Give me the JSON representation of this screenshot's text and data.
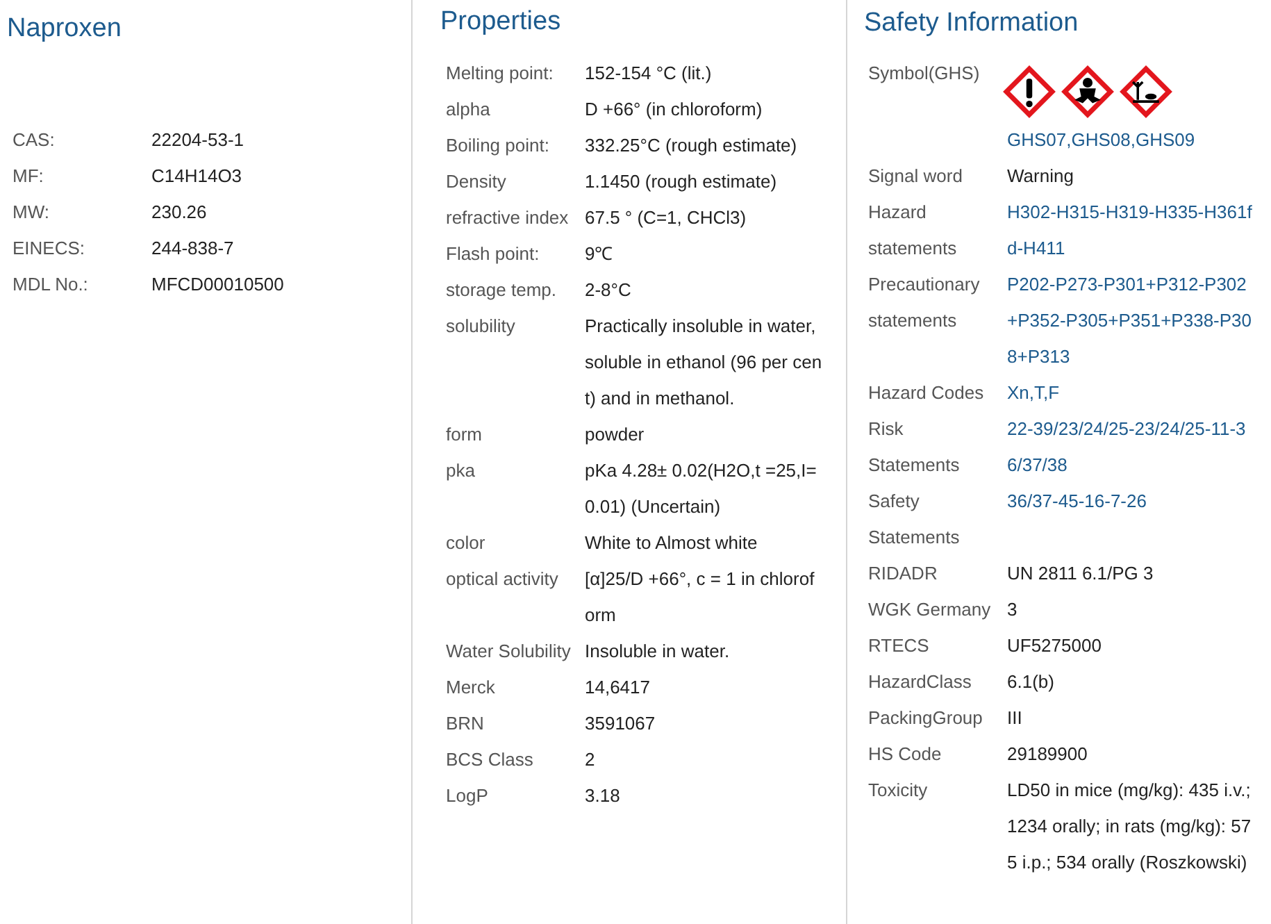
{
  "sections": [
    {
      "title": "Naproxen",
      "kind": "identity",
      "rows": [
        {
          "label": "CAS:",
          "value": "22204-53-1",
          "link": false
        },
        {
          "label": "MF:",
          "value": "C14H14O3",
          "link": false
        },
        {
          "label": "MW:",
          "value": "230.26",
          "link": false
        },
        {
          "label": "EINECS:",
          "value": "244-838-7",
          "link": false
        },
        {
          "label": "MDL No.:",
          "value": "MFCD00010500",
          "link": false
        }
      ]
    },
    {
      "title": "Properties",
      "kind": "properties",
      "rows": [
        {
          "label": "Melting point:",
          "value": "152-154 °C (lit.)",
          "link": false
        },
        {
          "label": "alpha",
          "value": "D +66° (in chloroform)",
          "link": false
        },
        {
          "label": "Boiling point:",
          "value": "332.25°C (rough estimate)",
          "link": false
        },
        {
          "label": "Density",
          "value": "1.1450 (rough estimate)",
          "link": false
        },
        {
          "label": "refractive index",
          "value": "67.5 ° (C=1, CHCl3)",
          "link": false
        },
        {
          "label": "Flash point:",
          "value": "9℃",
          "link": false
        },
        {
          "label": "storage temp.",
          "value": "2-8°C",
          "link": false
        },
        {
          "label": "solubility",
          "value": "Practically insoluble in water, soluble in ethanol (96 per cent) and in methanol.",
          "link": false
        },
        {
          "label": "form",
          "value": "powder",
          "link": false
        },
        {
          "label": "pka",
          "value": "pKa 4.28± 0.02(H2O,t =25,I=0.01) (Uncertain)",
          "link": false
        },
        {
          "label": "color",
          "value": "White to Almost white",
          "link": false
        },
        {
          "label": "optical activity",
          "value": "[α]25/D +66°, c = 1 in chloroform",
          "link": false
        },
        {
          "label": "Water Solubility",
          "value": "Insoluble in water.",
          "link": false
        },
        {
          "label": "Merck",
          "value": "14,6417",
          "link": false
        },
        {
          "label": "BRN",
          "value": "3591067",
          "link": false
        },
        {
          "label": "BCS Class",
          "value": "2",
          "link": false
        },
        {
          "label": "LogP",
          "value": "3.18",
          "link": false
        }
      ]
    },
    {
      "title": "Safety Information",
      "kind": "safety",
      "rows": [
        {
          "label": "Symbol(GHS)",
          "value": "GHS07,GHS08,GHS09",
          "link": true,
          "kind": "ghs"
        },
        {
          "label": "Signal word",
          "value": "Warning",
          "link": false
        },
        {
          "label": "Hazard statements",
          "value": "H302-H315-H319-H335-H361fd-H411",
          "link": true
        },
        {
          "label": "Precautionary statements",
          "value": "P202-P273-P301+P312-P302+P352-P305+P351+P338-P308+P313",
          "link": true
        },
        {
          "label": "Hazard Codes",
          "value": "Xn,T,F",
          "link": true
        },
        {
          "label": "Risk Statements",
          "value": "22-39/23/24/25-23/24/25-11-36/37/38",
          "link": true
        },
        {
          "label": "Safety Statements",
          "value": "36/37-45-16-7-26",
          "link": true
        },
        {
          "label": "RIDADR",
          "value": "UN 2811 6.1/PG 3",
          "link": false
        },
        {
          "label": "WGK Germany",
          "value": "3",
          "link": false
        },
        {
          "label": "RTECS",
          "value": "UF5275000",
          "link": false
        },
        {
          "label": "HazardClass",
          "value": "6.1(b)",
          "link": false
        },
        {
          "label": "PackingGroup",
          "value": "III",
          "link": false
        },
        {
          "label": "HS Code",
          "value": "29189900",
          "link": false
        },
        {
          "label": "Toxicity",
          "value": "LD50 in mice (mg/kg): 435 i.v.; 1234 orally; in rats (mg/kg): 575 i.p.; 534 orally (Roszkowski)",
          "link": false
        }
      ]
    }
  ]
}
